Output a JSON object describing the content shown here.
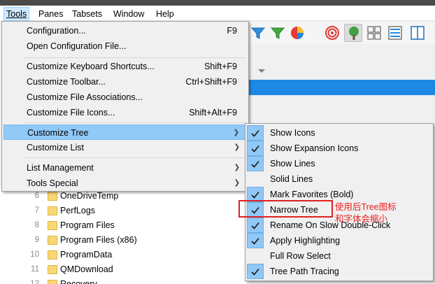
{
  "menubar": [
    {
      "label": "Tools",
      "active": true
    },
    {
      "label": "Panes"
    },
    {
      "label": "Tabsets"
    },
    {
      "label": "Window"
    },
    {
      "label": "Help"
    }
  ],
  "tools_menu": {
    "items": [
      {
        "label": "Configuration...",
        "shortcut": "F9"
      },
      {
        "label": "Open Configuration File...",
        "shortcut": ""
      },
      {
        "label": "Customize Keyboard Shortcuts...",
        "shortcut": "Shift+F9"
      },
      {
        "label": "Customize Toolbar...",
        "shortcut": "Ctrl+Shift+F9"
      },
      {
        "label": "Customize File Associations...",
        "shortcut": ""
      },
      {
        "label": "Customize File Icons...",
        "shortcut": "Shift+Alt+F9"
      },
      {
        "label": "Customize Tree",
        "submenu": true,
        "highlighted": true
      },
      {
        "label": "Customize List",
        "submenu": true
      },
      {
        "label": "List Management",
        "submenu": true
      },
      {
        "label": "Tools Special",
        "submenu": true
      }
    ]
  },
  "customize_tree_submenu": {
    "items": [
      {
        "label": "Show Icons",
        "checked": true
      },
      {
        "label": "Show Expansion Icons",
        "checked": true
      },
      {
        "label": "Show Lines",
        "checked": true
      },
      {
        "label": "Solid Lines",
        "checked": false
      },
      {
        "label": "Mark Favorites (Bold)",
        "checked": true
      },
      {
        "label": "Narrow Tree",
        "checked": true
      },
      {
        "label": "Rename On Slow Double-Click",
        "checked": true
      },
      {
        "label": "Apply Highlighting",
        "checked": true
      },
      {
        "label": "Full Row Select",
        "checked": false
      },
      {
        "label": "Tree Path Tracing",
        "checked": true
      }
    ]
  },
  "tree": {
    "rows": [
      {
        "num": "6",
        "name": "OneDriveTemp"
      },
      {
        "num": "7",
        "name": "PerfLogs"
      },
      {
        "num": "8",
        "name": "Program Files"
      },
      {
        "num": "9",
        "name": "Program Files (x86)"
      },
      {
        "num": "10",
        "name": "ProgramData"
      },
      {
        "num": "11",
        "name": "QMDownload"
      },
      {
        "num": "12",
        "name": "Recovery"
      }
    ]
  },
  "annotation": {
    "line1": "使用后Tree图标",
    "line2": "和字体会缩小"
  },
  "toolbar": {
    "icons": [
      "funnel-blue-icon",
      "funnel-green-icon",
      "pie-chart-icon",
      "spiral-icon",
      "tree-icon",
      "grid-icon",
      "list-icon",
      "dual-pane-icon"
    ]
  },
  "colors": {
    "highlight": "#91c9f7",
    "accent_bar": "#1e88e5",
    "annotation": "#e02020"
  }
}
